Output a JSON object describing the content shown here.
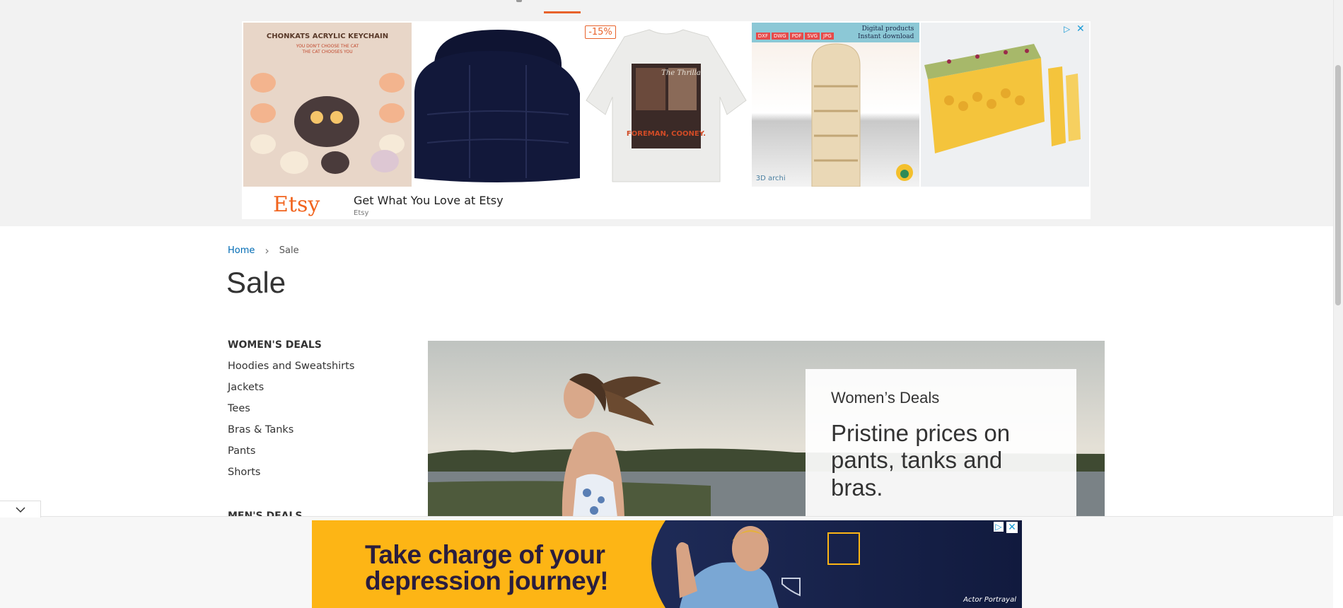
{
  "top_ad": {
    "tile1_title": "CHONKATS ACRYLIC KEYCHAIN",
    "tile1_sub1": "YOU DON'T CHOOSE THE CAT",
    "tile1_sub2": "THE CAT CHOOSES YOU",
    "tile3_discount": "-15%",
    "tile3_shirt_top": "The Thrilla",
    "tile3_shirt_main": "FOREMAN, COONEY.",
    "tile4_badges": [
      "DXF",
      "DWG",
      "PDF",
      "SVG",
      "JPG"
    ],
    "tile4_text1": "Digital products",
    "tile4_text2": "Instant download",
    "tile4_brand": "3D archi",
    "brand": "Etsy",
    "headline": "Get What You Love at Etsy",
    "sponsor": "Etsy"
  },
  "breadcrumb": {
    "home": "Home",
    "current": "Sale"
  },
  "page_title": "Sale",
  "sidebar": {
    "women_heading": "WOMEN'S DEALS",
    "women_items": [
      {
        "label": "Hoodies and Sweatshirts"
      },
      {
        "label": "Jackets"
      },
      {
        "label": "Tees"
      },
      {
        "label": "Bras & Tanks"
      },
      {
        "label": "Pants"
      },
      {
        "label": "Shorts"
      }
    ],
    "men_heading": "MEN'S DEALS"
  },
  "hero": {
    "kicker": "Women’s Deals",
    "headline": "Pristine prices on pants, tanks and bras."
  },
  "bottom_ad": {
    "line1": "Take charge of your",
    "line2": "depression journey!",
    "portrayal": "Actor Portrayal"
  },
  "colors": {
    "accent": "#e8622b",
    "link": "#006bb4",
    "etsy_orange": "#f1641e",
    "ad_yellow": "#fdb515",
    "ad_navy": "#1f2a55"
  }
}
